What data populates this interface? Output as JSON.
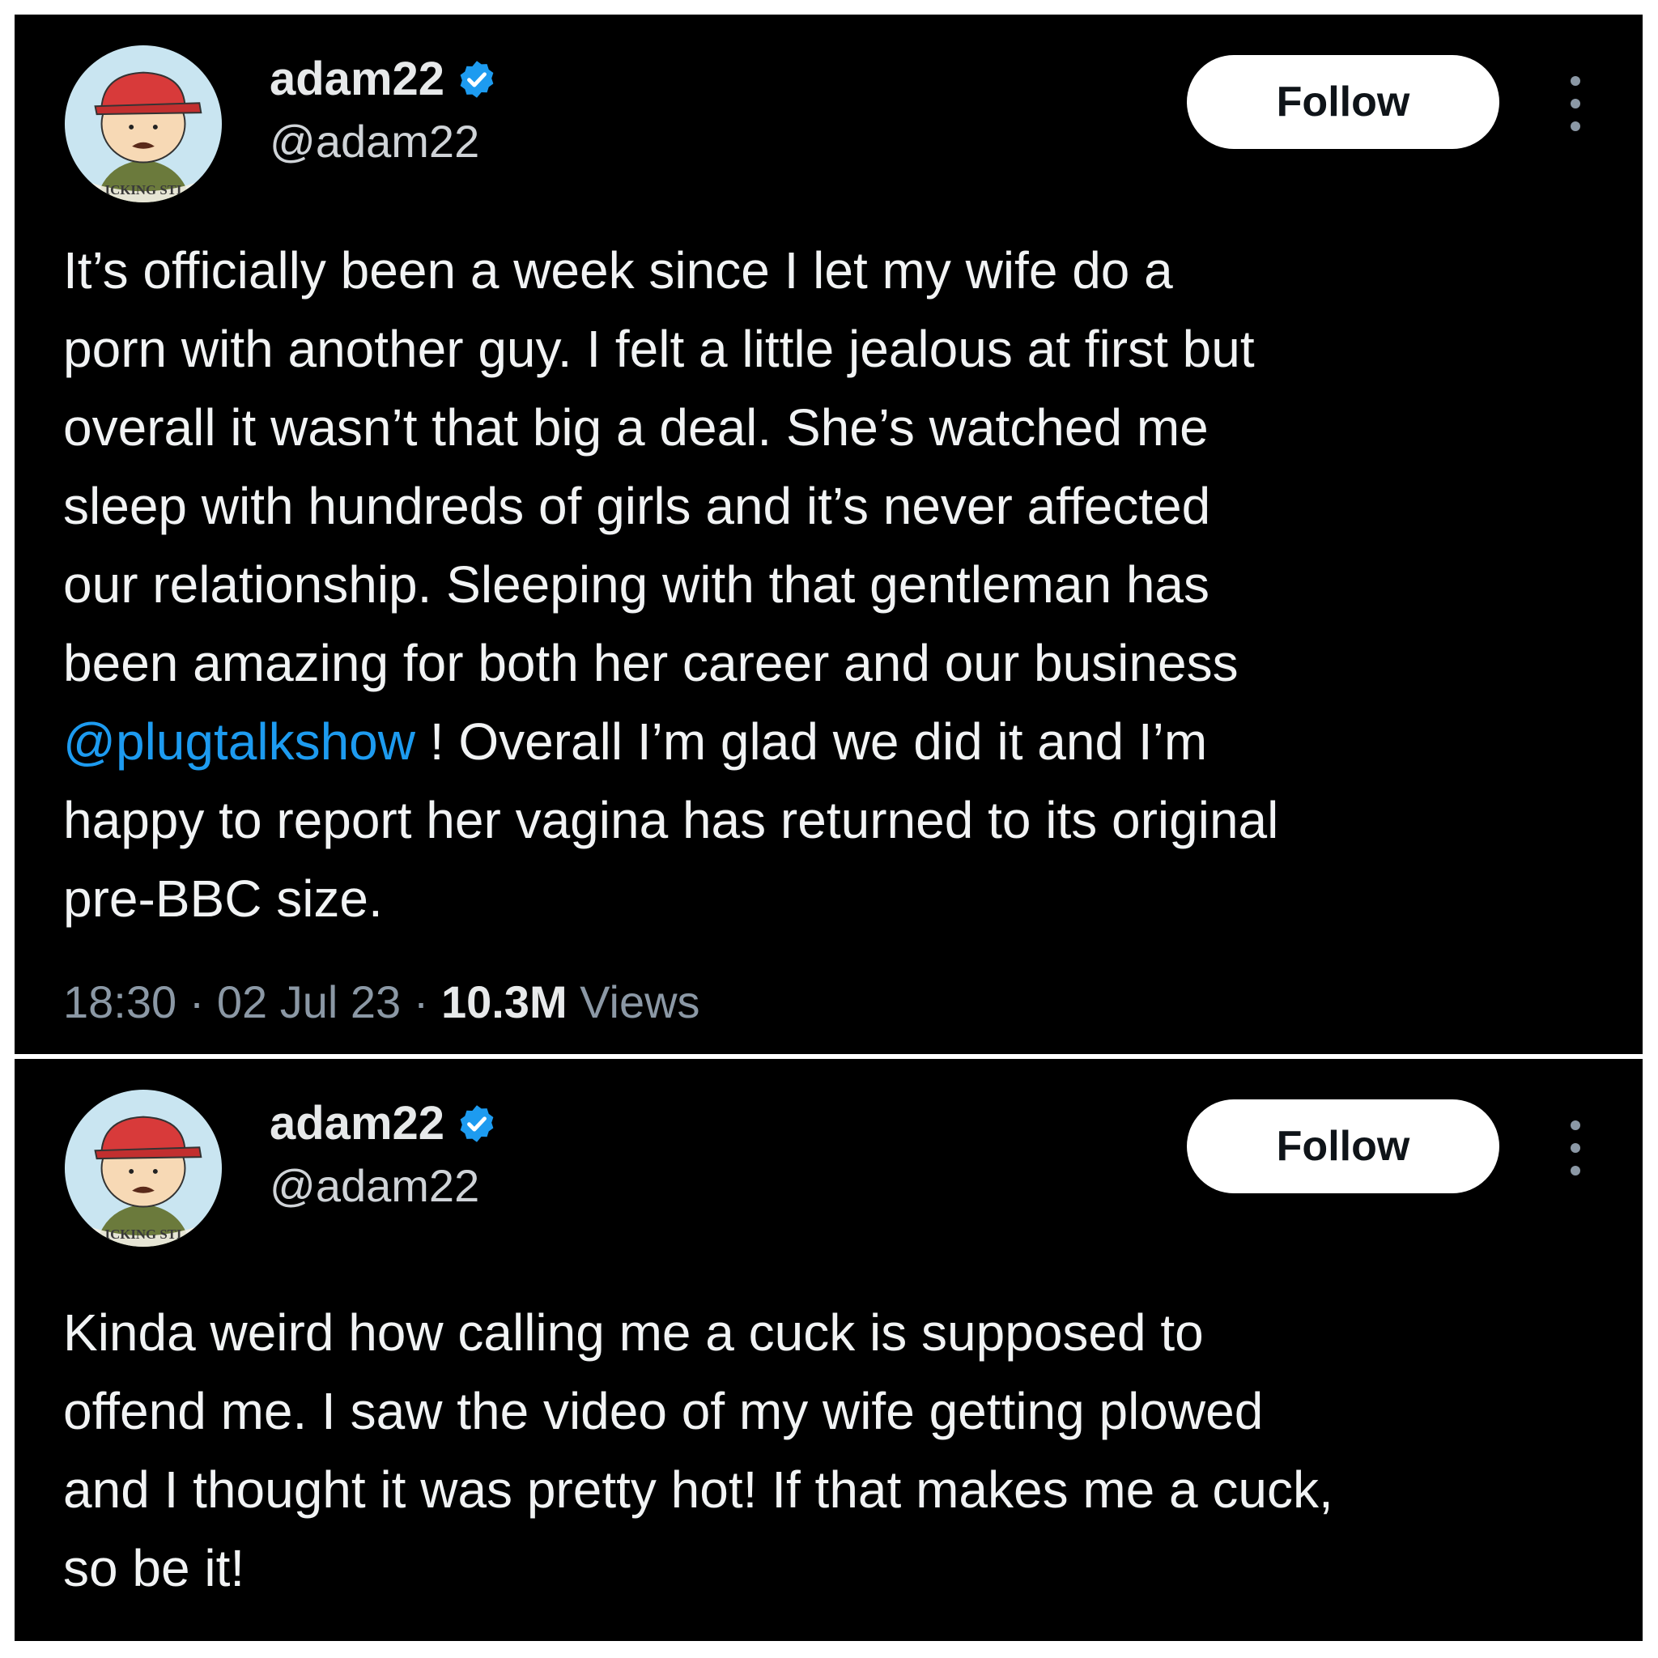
{
  "colors": {
    "background": "#000000",
    "text": "#e7e9ea",
    "secondary": "#8b98a5",
    "link": "#1d9bf0",
    "verified": "#1d9bf0",
    "follow_bg": "#ffffff",
    "follow_text": "#0f1419"
  },
  "tweets": [
    {
      "user": {
        "name": "adam22",
        "handle": "@adam22",
        "avatar_badge_text": "ICKING STI",
        "verified_icon": "verified-badge-icon"
      },
      "follow_label": "Follow",
      "more_icon": "more-vertical-icon",
      "text_before": "It’s officially been a week since I let my wife do a\nporn with another guy. I felt a little jealous at first but\noverall it wasn’t that big a deal. She’s watched me\nsleep with hundreds of girls and it’s never affected\nour relationship. Sleeping with that gentleman has\nbeen amazing for both her career and our business\n",
      "mention": "@plugtalkshow",
      "text_after": " ! Overall I’m glad we did it and I’m\nhappy to report her vagina has returned to its original\npre-BBC size.",
      "time": "18:30",
      "date": "02 Jul 23",
      "views_count": "10.3M",
      "views_label": "Views"
    },
    {
      "user": {
        "name": "adam22",
        "handle": "@adam22",
        "avatar_badge_text": "ICKING STI",
        "verified_icon": "verified-badge-icon"
      },
      "follow_label": "Follow",
      "more_icon": "more-vertical-icon",
      "text": "Kinda weird how calling me a cuck is supposed to\noffend me. I saw the video of my wife getting plowed\nand I thought it was pretty hot! If that makes me a cuck,\nso be it!"
    }
  ]
}
